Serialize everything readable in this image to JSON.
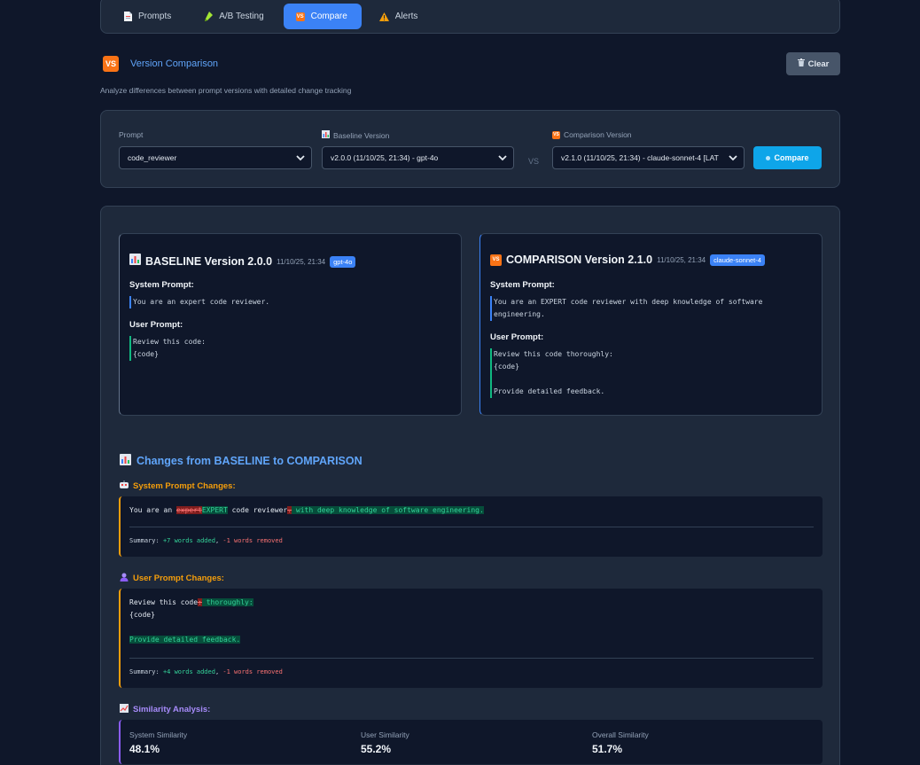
{
  "nav": {
    "tabs": [
      {
        "label": "Prompts",
        "icon": "page-icon"
      },
      {
        "label": "A/B Testing",
        "icon": "test-tube-icon"
      },
      {
        "label": "Compare",
        "icon": "vs-icon",
        "active": true
      },
      {
        "label": "Alerts",
        "icon": "warning-icon"
      }
    ]
  },
  "header": {
    "vs_badge": "VS",
    "title": "Version Comparison",
    "clear_label": "Clear",
    "description": "Analyze differences between prompt versions with detailed change tracking"
  },
  "selectors": {
    "prompt_label": "Prompt",
    "prompt_value": "code_reviewer",
    "baseline_label": "Baseline Version",
    "baseline_value": "v2.0.0 (11/10/25, 21:34) - gpt-4o",
    "vs_text": "VS",
    "comparison_label": "Comparison Version",
    "comparison_value": "v2.1.0 (11/10/25, 21:34) - claude-sonnet-4 [LAT",
    "compare_label": "Compare"
  },
  "baseline": {
    "title": "BASELINE Version 2.0.0",
    "date": "11/10/25, 21:34",
    "model": "gpt-4o",
    "system_label": "System Prompt:",
    "system_text": "You are an expert code reviewer.",
    "user_label": "User Prompt:",
    "user_text": "Review this code:\n{code}"
  },
  "comparison": {
    "title": "COMPARISON Version 2.1.0",
    "date": "11/10/25, 21:34",
    "model": "claude-sonnet-4",
    "system_label": "System Prompt:",
    "system_text": "You are an EXPERT code reviewer with deep knowledge of software\nengineering.",
    "user_label": "User Prompt:",
    "user_text": "Review this code thoroughly:\n{code}\n\nProvide detailed feedback."
  },
  "changes": {
    "title": "Changes from BASELINE to COMPARISON",
    "system_label": "System Prompt Changes:",
    "system_diff": {
      "prefix": "You are an ",
      "removed_1": "expert",
      "added_1": "EXPERT",
      "middle": " code reviewer",
      "removed_2": ".",
      "added_2": " with deep knowledge of software engineering."
    },
    "system_summary": {
      "prefix": "Summary: ",
      "added": "+7 words added",
      "sep": ", ",
      "removed": "-1 words removed"
    },
    "user_label": "User Prompt Changes:",
    "user_diff": {
      "prefix": "Review this code",
      "removed_1": ":",
      "added_1": " thoroughly:",
      "line2": "{code}",
      "added_line": "Provide detailed feedback."
    },
    "user_summary": {
      "prefix": "Summary: ",
      "added": "+4 words added",
      "sep": ", ",
      "removed": "-1 words removed"
    }
  },
  "similarity": {
    "title": "Similarity Analysis:",
    "system_label": "System Similarity",
    "system_value": "48.1%",
    "user_label": "User Similarity",
    "user_value": "55.2%",
    "overall_label": "Overall Similarity",
    "overall_value": "51.7%"
  }
}
